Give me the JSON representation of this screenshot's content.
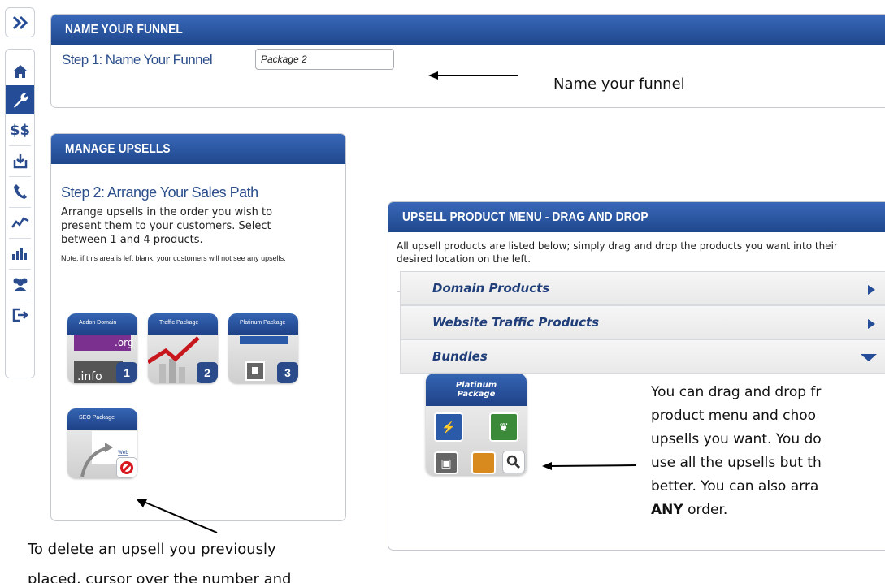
{
  "sidebar": {
    "expand_icon": "double-chevron-right-icon",
    "items": [
      {
        "name": "home-icon",
        "glyph": "⌂",
        "active": false
      },
      {
        "name": "wrench-icon",
        "glyph": "🔧",
        "active": true
      },
      {
        "name": "dollar-icon",
        "glyph": "$$",
        "active": false
      },
      {
        "name": "download-icon",
        "glyph": "⤓",
        "active": false
      },
      {
        "name": "phone-icon",
        "glyph": "✆",
        "active": false
      },
      {
        "name": "trend-chart-icon",
        "glyph": "〽",
        "active": false
      },
      {
        "name": "bar-chart-icon",
        "glyph": "▥",
        "active": false
      },
      {
        "name": "users-icon",
        "glyph": "👥",
        "active": false
      },
      {
        "name": "logout-icon",
        "glyph": "⇥",
        "active": false
      }
    ]
  },
  "name_funnel": {
    "header": "NAME YOUR FUNNEL",
    "step_label": "Step 1: Name Your Funnel",
    "input_value": "Package 2"
  },
  "manage_upsells": {
    "header": "MANAGE UPSELLS",
    "step_title": "Step 2: Arrange Your Sales Path",
    "description": "Arrange upsells in the order you wish to present them to your customers. Select between 1 and 4 products.",
    "note": "Note: if this area is left blank, your customers will not see any upsells.",
    "upsells": [
      {
        "title": "Addon Domain",
        "number": "1"
      },
      {
        "title": "Traffic Package",
        "number": "2"
      },
      {
        "title": "Platinum Package",
        "number": "3"
      },
      {
        "title": "SEO Package",
        "number": ""
      }
    ]
  },
  "product_menu": {
    "header": "UPSELL PRODUCT MENU - DRAG AND DROP",
    "intro": "All upsell products are listed below; simply drag and drop the products you want into their desired location on the left.",
    "categories": [
      {
        "label": "Domain Products",
        "expanded": false
      },
      {
        "label": "Website Traffic Products",
        "expanded": false
      },
      {
        "label": "Bundles",
        "expanded": true
      }
    ],
    "bundle_product": {
      "title_line1": "Platinum",
      "title_line2": "Package"
    }
  },
  "annotations": {
    "name_funnel": "Name your funnel",
    "drag_drop_lines": [
      "You can drag and drop fr",
      "product menu and choo",
      "upsells you want. You do",
      "use all the upsells but th",
      "better. You can also arra"
    ],
    "drag_drop_last_bold": "ANY",
    "drag_drop_last_rest": " order.",
    "delete_line1": "To delete an upsell you previously",
    "delete_line2": "placed, cursor over the number and"
  },
  "colors": {
    "header_blue": "#1f478d",
    "accent_blue": "#254c96",
    "category_text": "#203f7a"
  }
}
